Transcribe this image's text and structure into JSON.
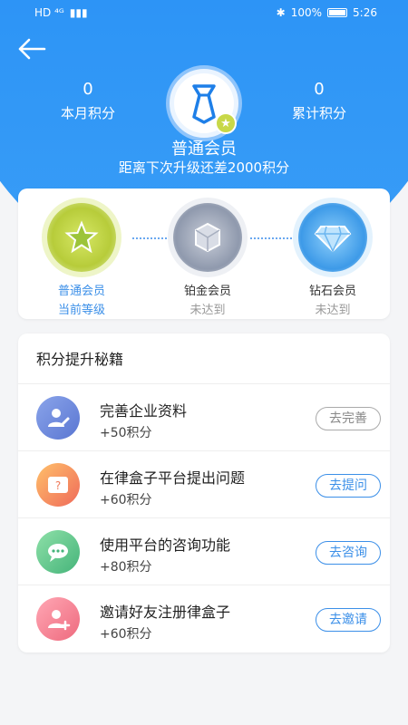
{
  "status_bar": {
    "left": "HD ⁴ᴳ",
    "battery": "100%",
    "time": "5:26"
  },
  "stats": {
    "month_points": {
      "value": "0",
      "label": "本月积分"
    },
    "total_points": {
      "value": "0",
      "label": "累计积分"
    }
  },
  "member": {
    "title": "普通会员",
    "subtitle": "距离下次升级还差2000积分"
  },
  "levels": [
    {
      "name": "普通会员",
      "state": "当前等级",
      "color": "#c6d941"
    },
    {
      "name": "铂金会员",
      "state": "未达到",
      "color": "#9aa4b8"
    },
    {
      "name": "钻石会员",
      "state": "未达到",
      "color": "#4aa3ef"
    }
  ],
  "tasks_title": "积分提升秘籍",
  "tasks": [
    {
      "title": "完善企业资料",
      "points": "+50积分",
      "button": "去完善",
      "icon": "edit-user-icon",
      "icon_color": "#6a86d8",
      "done": true
    },
    {
      "title": "在律盒子平台提出问题",
      "points": "+60积分",
      "button": "去提问",
      "icon": "question-icon",
      "icon_color": "#f08a5b",
      "done": false
    },
    {
      "title": "使用平台的咨询功能",
      "points": "+80积分",
      "button": "去咨询",
      "icon": "chat-icon",
      "icon_color": "#5ec08a",
      "done": false
    },
    {
      "title": "邀请好友注册律盒子",
      "points": "+60积分",
      "button": "去邀请",
      "icon": "invite-user-icon",
      "icon_color": "#f07a86",
      "done": false
    }
  ]
}
